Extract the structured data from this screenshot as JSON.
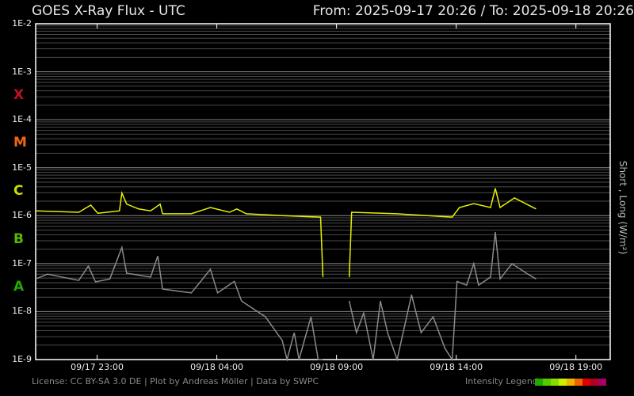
{
  "header": {
    "title": "GOES X-Ray Flux - UTC",
    "range": "From: 2025-09-17 20:26  /  To: 2025-09-18 20:26"
  },
  "footer": {
    "license": "License: CC BY-SA 3.0 DE | Plot by Andreas Möller | Data by SWPC",
    "legend_label": "Intensity Legend"
  },
  "legend_colors": [
    "#22aa00",
    "#55cc00",
    "#88dd00",
    "#ccee00",
    "#f0b400",
    "#ee6600",
    "#e00000",
    "#b00020",
    "#aa0066"
  ],
  "classes": [
    {
      "label": "X",
      "color": "#c0102a",
      "log10": -3.5
    },
    {
      "label": "M",
      "color": "#ee6611",
      "log10": -4.5
    },
    {
      "label": "C",
      "color": "#ccdd00",
      "log10": -5.5
    },
    {
      "label": "B",
      "color": "#55bb00",
      "log10": -6.5
    },
    {
      "label": "A",
      "color": "#22aa00",
      "log10": -7.5
    }
  ],
  "chart_data": {
    "type": "line",
    "title": "GOES X-Ray Flux - UTC",
    "ylabel": "Short , Long (W/m²)",
    "yscale": "log",
    "ylim_log10": [
      -9,
      -2
    ],
    "yticks": [
      "1E-2",
      "1E-3",
      "1E-4",
      "1E-5",
      "1E-6",
      "1E-7",
      "1E-8",
      "1E-9"
    ],
    "x_unit": "hours since 2025-09-17 20:26",
    "xlim": [
      0,
      24
    ],
    "xticks": [
      {
        "h": 2.567,
        "label": "09/17 23:00"
      },
      {
        "h": 7.567,
        "label": "09/18 04:00"
      },
      {
        "h": 12.567,
        "label": "09/18 09:00"
      },
      {
        "h": 17.567,
        "label": "09/18 14:00"
      },
      {
        "h": 22.567,
        "label": "09/18 19:00"
      }
    ],
    "series": [
      {
        "name": "Long",
        "color": "#e6f000",
        "points": [
          [
            0,
            -5.9
          ],
          [
            1.8,
            -5.93
          ],
          [
            2.3,
            -5.78
          ],
          [
            2.6,
            -5.95
          ],
          [
            3.5,
            -5.9
          ],
          [
            3.6,
            -5.53
          ],
          [
            3.8,
            -5.76
          ],
          [
            4.3,
            -5.86
          ],
          [
            4.8,
            -5.9
          ],
          [
            5.2,
            -5.76
          ],
          [
            5.3,
            -5.96
          ],
          [
            6.5,
            -5.96
          ],
          [
            7.3,
            -5.83
          ],
          [
            8.1,
            -5.93
          ],
          [
            8.4,
            -5.86
          ],
          [
            8.8,
            -5.96
          ],
          [
            10.3,
            -6.0
          ],
          [
            11.9,
            -6.03
          ],
          [
            12.0,
            -7.28
          ],
          null,
          [
            13.1,
            -7.28
          ],
          [
            13.2,
            -5.93
          ],
          [
            15.1,
            -5.96
          ],
          [
            17.4,
            -6.03
          ],
          [
            17.7,
            -5.83
          ],
          [
            18.3,
            -5.75
          ],
          [
            19.0,
            -5.83
          ],
          [
            19.2,
            -5.43
          ],
          [
            19.4,
            -5.83
          ],
          [
            20.0,
            -5.63
          ],
          [
            20.5,
            -5.76
          ],
          [
            20.9,
            -5.86
          ]
        ]
      },
      {
        "name": "Short",
        "color": "#8a8a8a",
        "points": [
          [
            0,
            -7.32
          ],
          [
            0.5,
            -7.22
          ],
          [
            1.8,
            -7.35
          ],
          [
            2.2,
            -7.05
          ],
          [
            2.5,
            -7.38
          ],
          [
            3.1,
            -7.32
          ],
          [
            3.6,
            -6.66
          ],
          [
            3.8,
            -7.2
          ],
          [
            4.8,
            -7.28
          ],
          [
            5.1,
            -6.84
          ],
          [
            5.3,
            -7.53
          ],
          [
            6.5,
            -7.61
          ],
          [
            7.3,
            -7.12
          ],
          [
            7.6,
            -7.61
          ],
          [
            8.3,
            -7.37
          ],
          [
            8.6,
            -7.78
          ],
          [
            9.6,
            -8.11
          ],
          [
            10.3,
            -8.6
          ],
          [
            10.5,
            -9.0
          ],
          [
            10.8,
            -8.44
          ],
          [
            11.0,
            -9.0
          ],
          [
            11.5,
            -8.11
          ],
          [
            11.8,
            -9.0
          ],
          [
            12.0,
            -9.0
          ],
          null,
          [
            13.1,
            -7.78
          ],
          [
            13.4,
            -8.44
          ],
          [
            13.7,
            -8.03
          ],
          [
            14.1,
            -9.0
          ],
          [
            14.4,
            -7.78
          ],
          [
            14.7,
            -8.44
          ],
          [
            15.1,
            -9.0
          ],
          [
            15.7,
            -7.65
          ],
          [
            16.1,
            -8.44
          ],
          [
            16.6,
            -8.11
          ],
          [
            17.1,
            -8.77
          ],
          [
            17.4,
            -9.0
          ],
          [
            17.6,
            -7.37
          ],
          [
            18.0,
            -7.45
          ],
          [
            18.3,
            -7.0
          ],
          [
            18.5,
            -7.45
          ],
          [
            19.0,
            -7.28
          ],
          [
            19.2,
            -6.34
          ],
          [
            19.4,
            -7.32
          ],
          [
            19.9,
            -7.0
          ],
          [
            20.5,
            -7.2
          ],
          [
            20.9,
            -7.32
          ]
        ]
      }
    ]
  }
}
